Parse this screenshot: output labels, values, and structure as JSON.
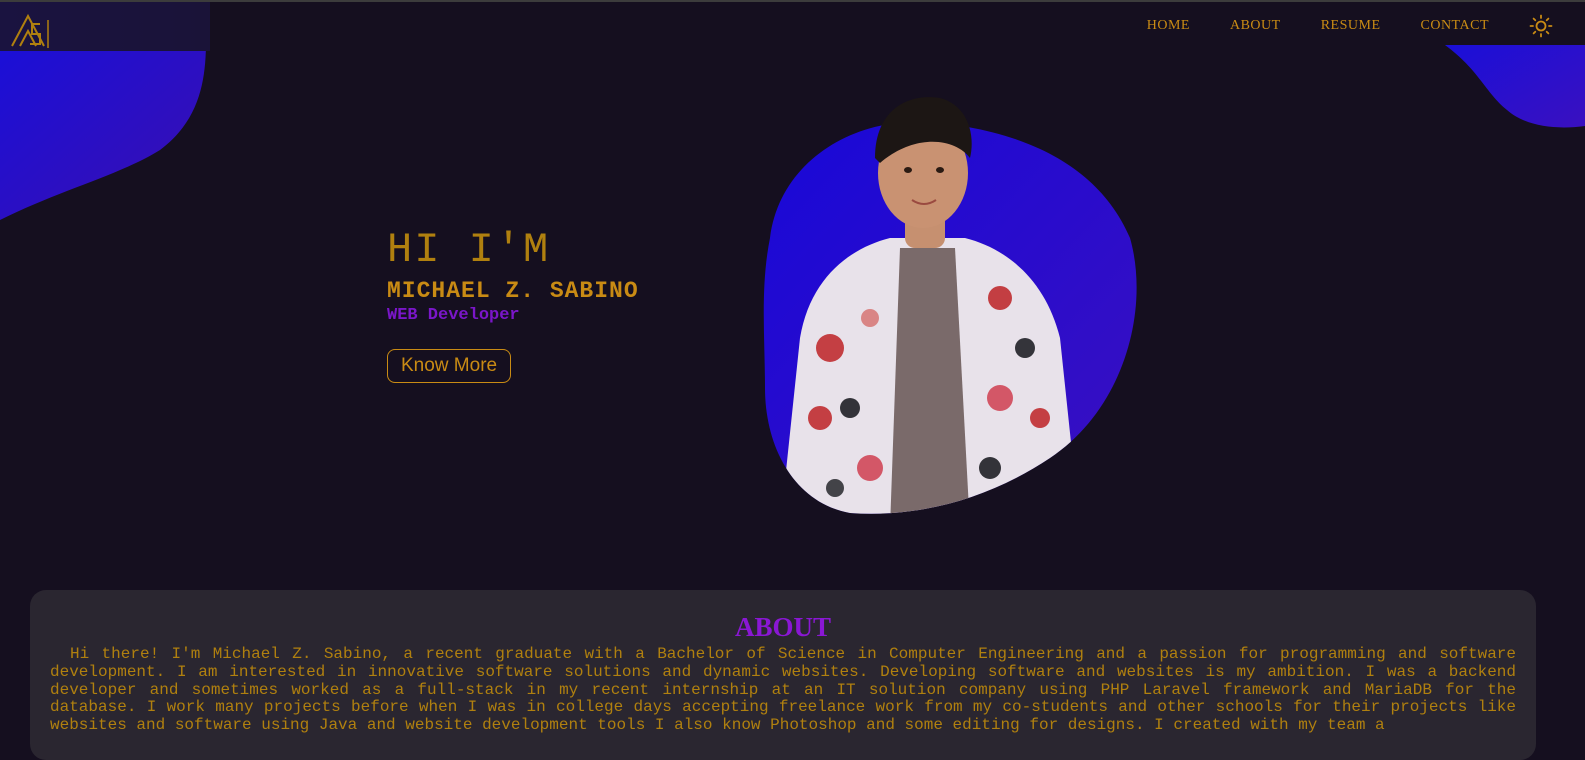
{
  "colors": {
    "background": "#150f1f",
    "accent_gold": "#c98b14",
    "accent_purple": "#7a16c9",
    "blob_blue": "#1a0fd0",
    "card": "#2a2630"
  },
  "header": {
    "logo_icon": "ms-monogram-logo-icon",
    "nav": [
      {
        "label": "HOME"
      },
      {
        "label": "ABOUT"
      },
      {
        "label": "RESUME"
      },
      {
        "label": "CONTACT"
      }
    ],
    "theme_toggle_icon": "sun-icon"
  },
  "hero": {
    "greeting": "HI I'M",
    "name": "MICHAEL Z. SABINO",
    "role": "WEB Developer",
    "button": "Know More"
  },
  "about": {
    "title": "ABOUT",
    "text": "Hi there! I'm Michael Z. Sabino, a recent graduate with a Bachelor of Science in Computer Engineering and a passion for programming and software development. I am interested in innovative software solutions and dynamic websites. Developing software and websites is my ambition. I was a backend developer and sometimes worked as a full-stack in my recent internship at an IT solution company using PHP Laravel framework and MariaDB for the database. I work many projects before when I was in college days accepting freelance work from my co-students and other schools for their projects like websites and software using Java and website development tools I also know Photoshop and some editing for designs. I created with my team a"
  }
}
